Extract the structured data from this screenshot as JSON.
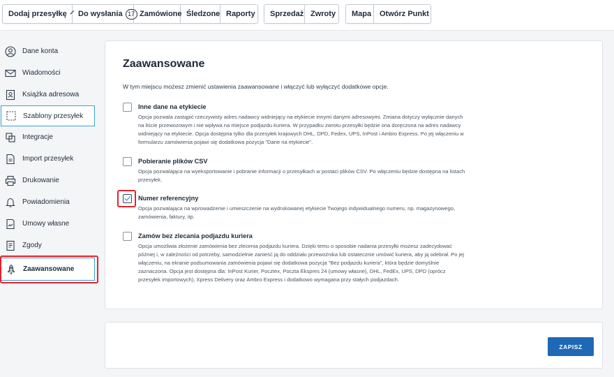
{
  "nav": {
    "group1": [
      {
        "label": "Dodaj przesyłkę"
      },
      {
        "label": "Do wysłania",
        "count": "17"
      },
      {
        "label": "Zamówione"
      },
      {
        "label": "Śledzone"
      },
      {
        "label": "Raporty"
      }
    ],
    "group2": [
      {
        "label": "Sprzedaż"
      },
      {
        "label": "Zwroty"
      }
    ],
    "group3": [
      {
        "label": "Mapa"
      },
      {
        "label": "Otwórz Punkt"
      }
    ]
  },
  "sidebar": {
    "items": [
      {
        "label": "Dane konta",
        "icon": "user-circle-icon"
      },
      {
        "label": "Wiadomości",
        "icon": "envelope-icon"
      },
      {
        "label": "Książka adresowa",
        "icon": "address-book-icon"
      },
      {
        "label": "Szablony przesyłek",
        "icon": "template-icon"
      },
      {
        "label": "Integracje",
        "icon": "integration-icon"
      },
      {
        "label": "Import przesyłek",
        "icon": "import-icon"
      },
      {
        "label": "Drukowanie",
        "icon": "printer-icon"
      },
      {
        "label": "Powiadomienia",
        "icon": "bell-icon"
      },
      {
        "label": "Umowy własne",
        "icon": "contract-icon"
      },
      {
        "label": "Zgody",
        "icon": "consent-icon"
      },
      {
        "label": "Zaawansowane",
        "icon": "rocket-icon"
      }
    ]
  },
  "main": {
    "title": "Zaawansowane",
    "intro": "W tym miejscu możesz zmienić ustawienia zaawansowane i włączyć lub wyłączyć dodatkowe opcje.",
    "options": [
      {
        "title": "Inne dane na etykiecie",
        "checked": false,
        "desc": "Opcja pozwala zastąpić rzeczywisty adres nadawcy widniejący na etykiecie innymi danymi adresowymi. Zmiana dotyczy wyłącznie danych na liście przewozowym i nie wpływa na miejsce podjazdu kuriera. W przypadku zwrotu przesyłki będzie ona doręczona na adres nadawcy widniejący na etykiecie. Opcja dostępna tylko dla przesyłek krajowych DHL, DPD, Fedex, UPS, InPost i Ambro Express. Po jej włączeniu w formularzu zamówienia pojawi się dodatkowa pozycja \"Dane na etykiecie\"."
      },
      {
        "title": "Pobieranie plików CSV",
        "checked": false,
        "desc": "Opcja pozwalająca na wyeksportowanie i pobranie informacji o przesyłkach w postaci plików CSV. Po włączeniu będzie dostępna na listach przesyłek."
      },
      {
        "title": "Numer referencyjny",
        "checked": true,
        "desc": "Opcja pozwalająca na wprowadzenie i umieszczenie na wydrukowanej etykiecie Twojego indywidualnego numeru, np. magazynowego, zamówienia, faktury, itp."
      },
      {
        "title": "Zamów bez zlecania podjazdu kuriera",
        "checked": false,
        "desc": "Opcja umożliwia złożenie zamówienia bez zlecenia podjazdu kuriera. Dzięki temu o sposobie nadania przesyłki możesz zadecydować później i, w zależności od potrzeby, samodzielnie zanieść ją do oddziału przewoźnika lub ostatecznie umówić kuriera, aby ją odebrał. Po jej włączeniu, na ekranie podsumowania zamówienia pojawi się dodatkowa pozycja \"Bez podjazdu kuriera\", która będzie domyślnie zaznaczona. Opcja jest dostępna dla: InPost Kurier, Pocztex, Poczta Ekspres 24 (umowy własne), DHL, FedEx, UPS, DPD (oprócz przesyłek importowych), Xpress Delivery oraz Ambro Express i dodatkowo wymagana przy stałych podjazdach."
      }
    ]
  },
  "footer": {
    "save_label": "ZAPISZ"
  },
  "colors": {
    "accent": "#1f68b5",
    "highlight": "#e0232e",
    "active_border": "#3ba3d0"
  }
}
